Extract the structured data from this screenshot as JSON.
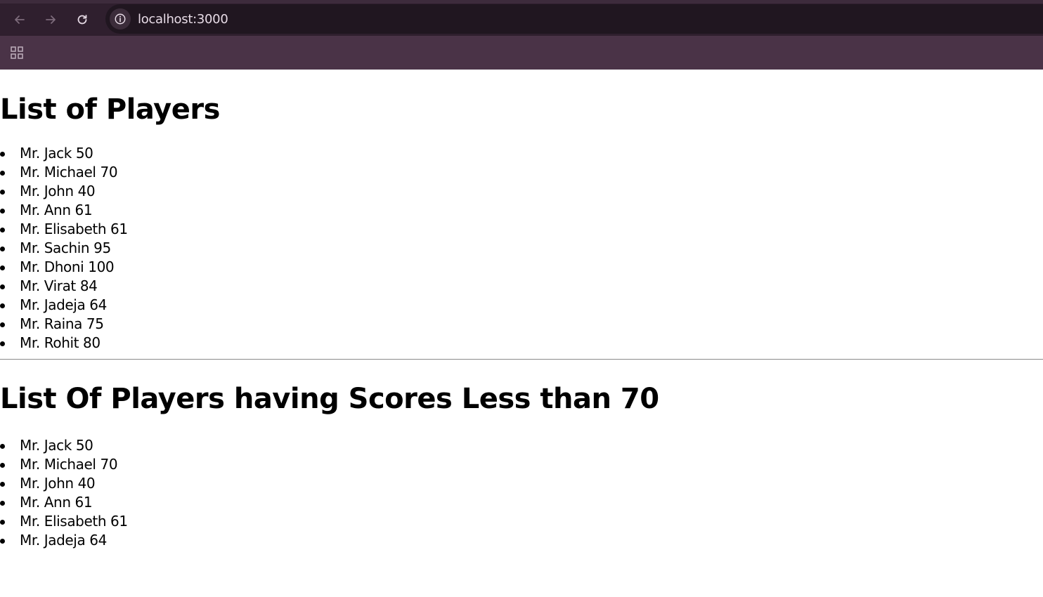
{
  "browser": {
    "url": "localhost:3000"
  },
  "page": {
    "heading1": "List of Players",
    "players": [
      "Mr. Jack 50",
      "Mr. Michael 70",
      "Mr. John 40",
      "Mr. Ann 61",
      "Mr. Elisabeth 61",
      "Mr. Sachin 95",
      "Mr. Dhoni 100",
      "Mr. Virat 84",
      "Mr. Jadeja 64",
      "Mr. Raina 75",
      "Mr. Rohit 80"
    ],
    "heading2": "List Of Players having Scores Less than 70",
    "filtered_players": [
      "Mr. Jack 50",
      "Mr. Michael 70",
      "Mr. John 40",
      "Mr. Ann 61",
      "Mr. Elisabeth 61",
      "Mr. Jadeja 64"
    ]
  }
}
